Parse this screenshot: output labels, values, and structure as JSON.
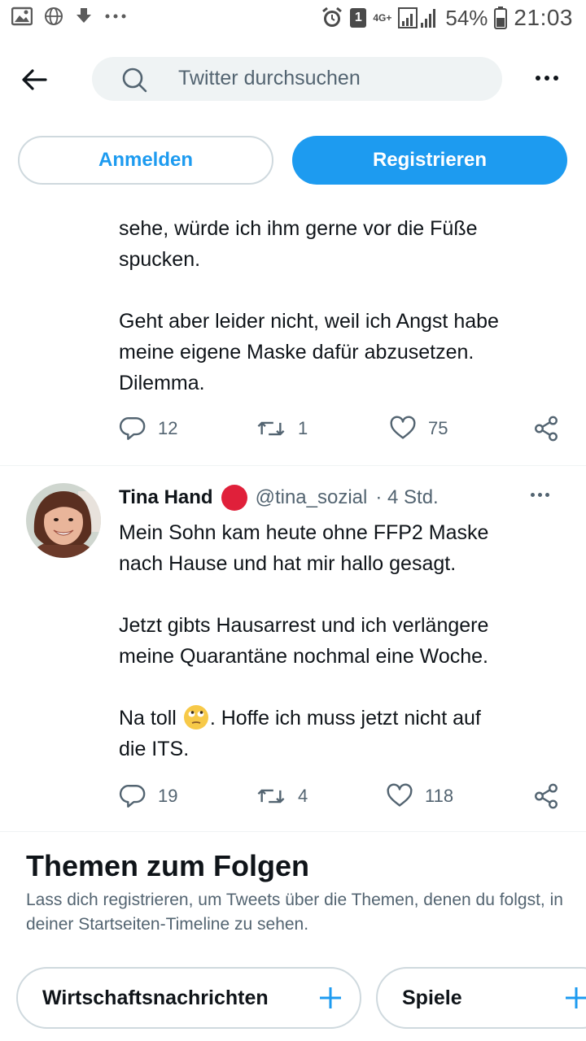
{
  "status_bar": {
    "battery_percent": "54%",
    "time": "21:03",
    "sim_slot": "1",
    "network_type": "4G+",
    "left_icons": [
      "image-icon",
      "globe-icon",
      "download-icon",
      "more-dots-icon"
    ]
  },
  "header": {
    "search_placeholder": "Twitter durchsuchen"
  },
  "auth": {
    "login_label": "Anmelden",
    "signup_label": "Registrieren"
  },
  "tweets": [
    {
      "text": "sehe, würde ich ihm gerne vor die Füße\nspucken.\n\nGeht aber leider nicht, weil ich Angst habe\nmeine eigene Maske dafür abzusetzen.\nDilemma.",
      "replies": "12",
      "retweets": "1",
      "likes": "75"
    },
    {
      "name": "Tina Hand",
      "handle": "@tina_sozial",
      "time": "· 4 Std.",
      "text_1": "Mein Sohn kam heute ohne FFP2 Maske\nnach Hause und hat mir hallo gesagt.\n\nJetzt gibts Hausarrest und ich verlängere\nmeine Quarantäne nochmal eine Woche.\n\nNa toll ",
      "text_2": ". Hoffe ich muss jetzt nicht auf\ndie ITS.",
      "replies": "19",
      "retweets": "4",
      "likes": "118"
    }
  ],
  "topics": {
    "title": "Themen zum Folgen",
    "subtitle": "Lass dich registrieren, um Tweets über die Themen, denen du folgst, in deiner Startseiten-Timeline zu sehen.",
    "chips": [
      {
        "label": "Wirtschaftsnachrichten"
      },
      {
        "label": "Spiele"
      }
    ]
  },
  "colors": {
    "accent": "#1d9bf0",
    "text_primary": "#0f1419",
    "text_secondary": "#536471",
    "badge_red": "#e0203a"
  }
}
